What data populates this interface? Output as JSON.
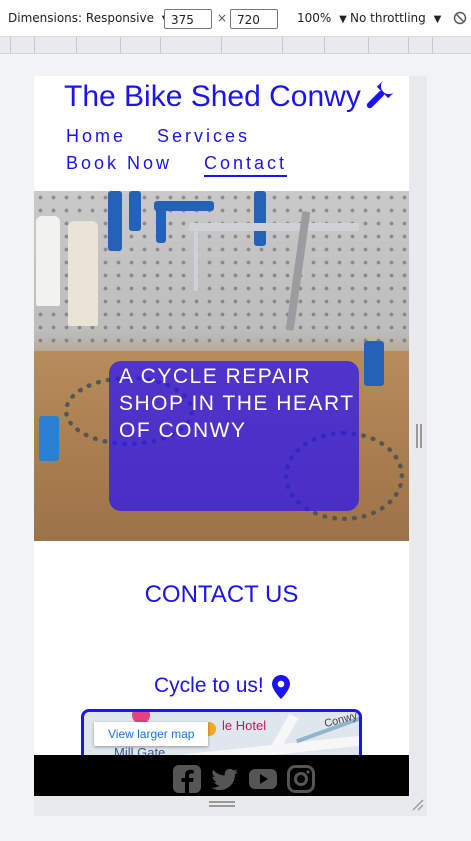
{
  "devtools": {
    "dimensions_label": "Dimensions: Responsive",
    "width_value": "375",
    "times": "×",
    "height_value": "720",
    "zoom": "100%",
    "throttling": "No throttling"
  },
  "site": {
    "title": "The Bike Shed Conwy",
    "brand_color": "#1a14f0",
    "nav": {
      "home": "Home",
      "services": "Services",
      "book_now": "Book Now",
      "contact": "Contact"
    },
    "hero": {
      "heading": "A CYCLE REPAIR SHOP IN THE HEART OF CONWY"
    },
    "contact": {
      "heading": "CONTACT US",
      "cycle_to_us": "Cycle to us!",
      "map": {
        "view_larger": "View larger map",
        "label_hotel": "le Hotel",
        "label_mill_gate": "Mill Gate",
        "label_conwy": "Conwy"
      }
    },
    "footer": {
      "icons": [
        "facebook-icon",
        "twitter-icon",
        "youtube-icon",
        "instagram-icon"
      ]
    }
  }
}
